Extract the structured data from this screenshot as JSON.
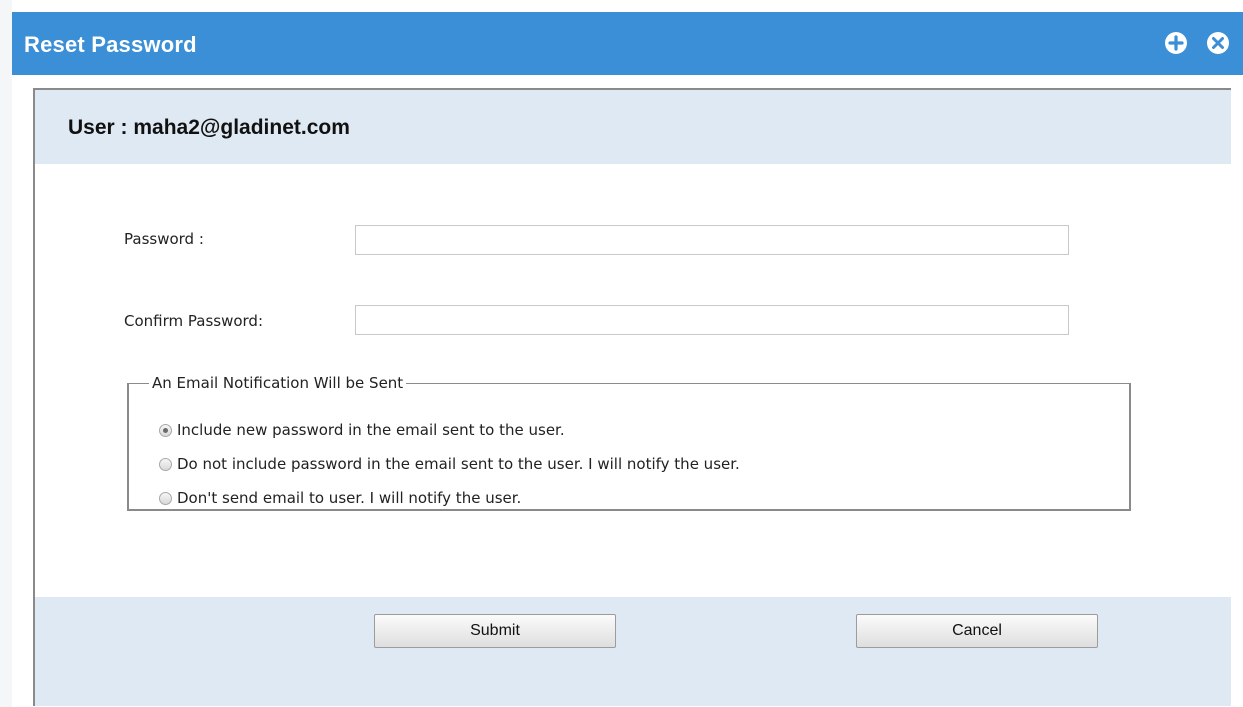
{
  "dialog": {
    "title": "Reset Password",
    "titlebar_color": "#3a8fd6",
    "icons": [
      "plus-circle-icon",
      "close-circle-icon"
    ]
  },
  "user": {
    "label": "User : maha2@gladinet.com"
  },
  "form": {
    "password_label": "Password :",
    "password_value": "",
    "confirm_label": "Confirm Password:",
    "confirm_value": ""
  },
  "notification": {
    "legend": "An Email Notification Will be Sent",
    "options": [
      {
        "label": "Include new password in the email sent to the user.",
        "checked": true
      },
      {
        "label": "Do not include password in the email sent to the user. I will notify the user.",
        "checked": false
      },
      {
        "label": "Don't send email to user. I will notify the user.",
        "checked": false
      }
    ]
  },
  "buttons": {
    "submit": "Submit",
    "cancel": "Cancel"
  },
  "colors": {
    "band_background": "#dfe9f4"
  }
}
